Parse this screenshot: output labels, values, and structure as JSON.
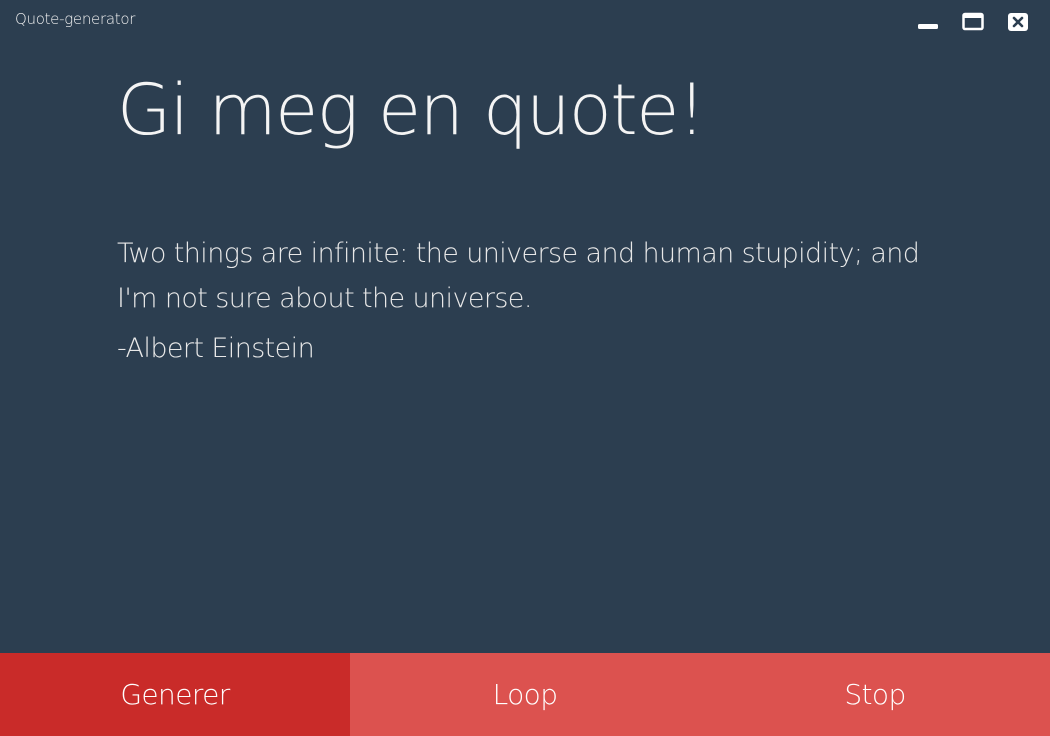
{
  "window": {
    "title": "Quote-generator",
    "controls": {
      "minimize_icon": "minimize-icon",
      "maximize_icon": "maximize-icon",
      "close_icon": "close-icon"
    }
  },
  "main": {
    "heading": "Gi meg en quote!",
    "quote_text": "Two things are infinite: the universe and human stupidity; and I'm not sure about the universe.",
    "quote_author": "-Albert Einstein"
  },
  "buttons": {
    "generate_label": "Generer",
    "loop_label": "Loop",
    "stop_label": "Stop"
  },
  "colors": {
    "background": "#2c3e50",
    "button": "#dc524f",
    "button_active": "#c92b29",
    "text": "#f4f4f4"
  }
}
